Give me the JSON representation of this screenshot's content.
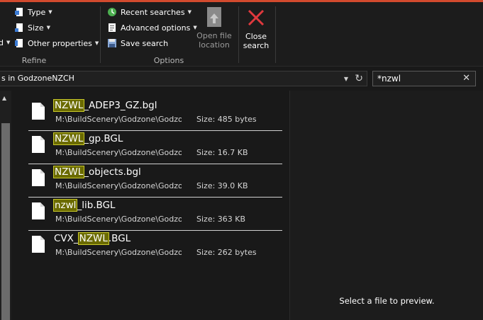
{
  "ribbon": {
    "refine": {
      "label": "Refine",
      "type_label": "Type",
      "size_label": "Size",
      "other_properties_label": "Other properties",
      "partial_left_label": "d"
    },
    "options": {
      "label": "Options",
      "recent_searches_label": "Recent searches",
      "advanced_options_label": "Advanced options",
      "save_search_label": "Save search",
      "open_file_location_line1": "Open file",
      "open_file_location_line2": "location"
    },
    "close": {
      "line1": "Close",
      "line2": "search"
    }
  },
  "address": {
    "path_text": "s in GodzoneNZCH"
  },
  "search": {
    "value": "*nzwl"
  },
  "results": [
    {
      "pre": "",
      "match": "NZWL",
      "post": "_ADEP3_GZ.bgl",
      "path": "M:\\BuildScenery\\Godzone\\Godzone\\Scenery",
      "size": "Size: 485 bytes"
    },
    {
      "pre": "",
      "match": "NZWL",
      "post": "_gp.BGL",
      "path": "M:\\BuildScenery\\Godzone\\Godzone\\Scenery",
      "size": "Size: 16.7 KB"
    },
    {
      "pre": "",
      "match": "NZWL",
      "post": "_objects.bgl",
      "path": "M:\\BuildScenery\\Godzone\\Godzone\\Scenery",
      "size": "Size: 39.0 KB"
    },
    {
      "pre": "",
      "match": "nzwl",
      "post": "_lib.BGL",
      "path": "M:\\BuildScenery\\Godzone\\Godzone\\Scenery",
      "size": "Size: 363 KB"
    },
    {
      "pre": "CVX_",
      "match": "NZWL",
      "post": ".BGL",
      "path": "M:\\BuildScenery\\Godzone\\Godzone\\Scenery",
      "size": "Size: 262 bytes"
    }
  ],
  "preview": {
    "message": "Select a file to preview."
  },
  "colors": {
    "accent_top": "#d24a2e",
    "highlight_bg": "#6b6b00",
    "close_x": "#e0393e"
  }
}
